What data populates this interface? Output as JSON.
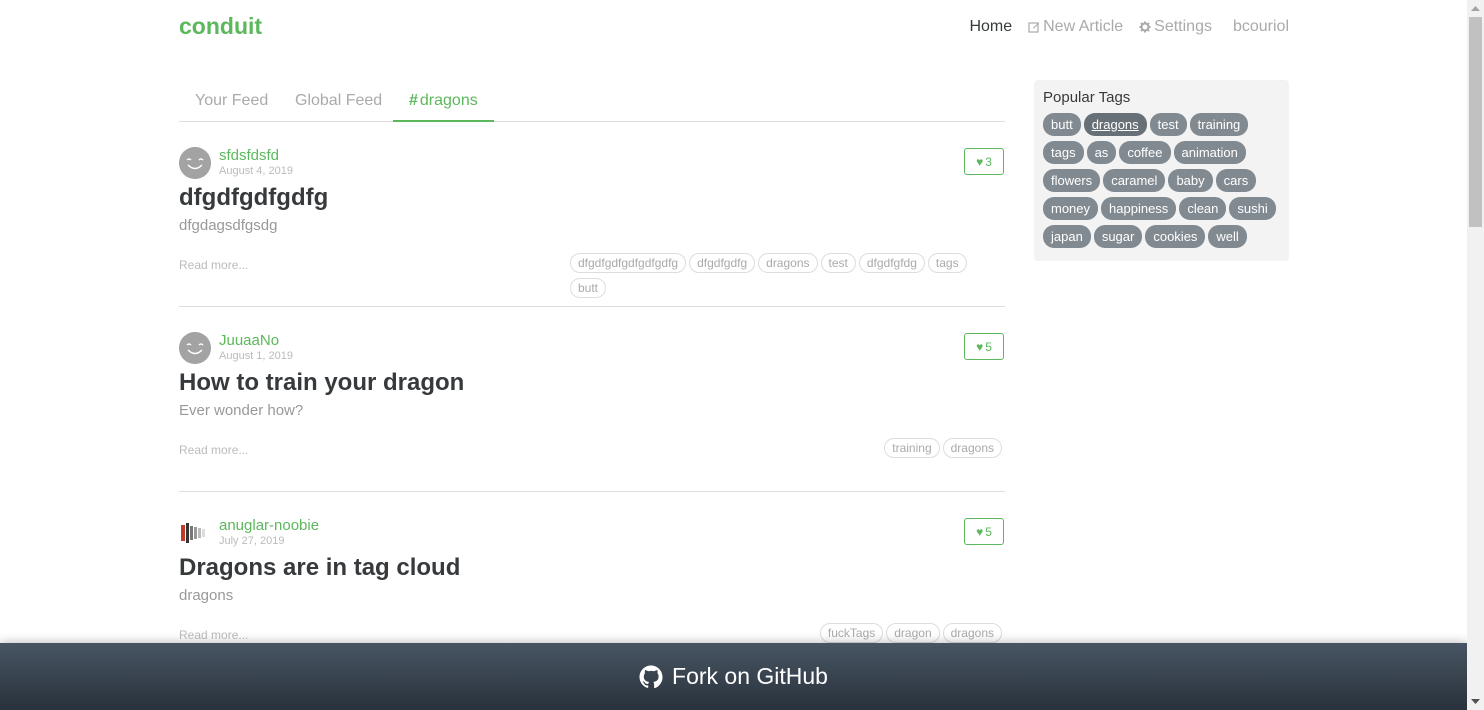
{
  "navbar": {
    "brand": "conduit",
    "links": {
      "home": "Home",
      "new_article": "New Article",
      "settings": "Settings",
      "user": "bcouriol"
    }
  },
  "feed_tabs": {
    "your_feed": "Your Feed",
    "global_feed": "Global Feed",
    "tag_feed": "dragons"
  },
  "articles": [
    {
      "author": "sfdsfdsfd",
      "date": "August 4, 2019",
      "favorites": "3",
      "title": "dfgdfgdfgdfg",
      "description": "dfgdagsdfgsdg",
      "read_more": "Read more...",
      "tags": [
        "dfgdfgdfgdfgdfgdfg",
        "dfgdfgdfg",
        "dragons",
        "test",
        "dfgdfgfdg",
        "tags",
        "butt"
      ]
    },
    {
      "author": "JuuaaNo",
      "date": "August 1, 2019",
      "favorites": "5",
      "title": "How to train your dragon",
      "description": "Ever wonder how?",
      "read_more": "Read more...",
      "tags": [
        "training",
        "dragons"
      ]
    },
    {
      "author": "anuglar-noobie",
      "date": "July 27, 2019",
      "favorites": "5",
      "title": "Dragons are in tag cloud",
      "description": "dragons",
      "read_more": "Read more...",
      "tags": [
        "fuckTags",
        "dragon",
        "dragons"
      ]
    }
  ],
  "sidebar": {
    "title": "Popular Tags",
    "selected_tag": "dragons",
    "tags": [
      "butt",
      "dragons",
      "test",
      "training",
      "tags",
      "as",
      "coffee",
      "animation",
      "flowers",
      "caramel",
      "baby",
      "cars",
      "money",
      "happiness",
      "clean",
      "sushi",
      "japan",
      "sugar",
      "cookies",
      "well"
    ]
  },
  "footer": {
    "github_label": "Fork on GitHub"
  },
  "colors": {
    "brand": "#5cb85c",
    "tag_pill": "#818a91",
    "banner_top": "#485563",
    "banner_bottom": "#29323c"
  }
}
